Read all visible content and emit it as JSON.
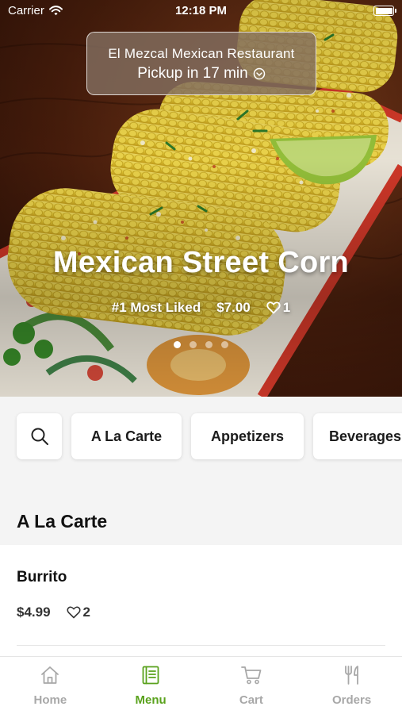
{
  "status_bar": {
    "carrier": "Carrier",
    "time": "12:18 PM"
  },
  "hero": {
    "restaurant": "El Mezcal Mexican Restaurant",
    "pickup": "Pickup in 17 min",
    "dish_name": "Mexican Street Corn",
    "rank": "#1 Most Liked",
    "price": "$7.00",
    "likes": "1",
    "slide_count": 4,
    "active_slide": 1
  },
  "categories": [
    "A La Carte",
    "Appetizers",
    "Beverages"
  ],
  "section": {
    "title": "A La Carte",
    "items": [
      {
        "name": "Burrito",
        "price": "$4.99",
        "likes": "2"
      }
    ]
  },
  "tabs": [
    {
      "label": "Home",
      "icon": "home-icon",
      "active": false
    },
    {
      "label": "Menu",
      "icon": "menu-book-icon",
      "active": true
    },
    {
      "label": "Cart",
      "icon": "cart-icon",
      "active": false
    },
    {
      "label": "Orders",
      "icon": "fork-knife-icon",
      "active": false
    }
  ],
  "colors": {
    "accent": "#5aa21d",
    "inactive": "#a8a8a8"
  }
}
